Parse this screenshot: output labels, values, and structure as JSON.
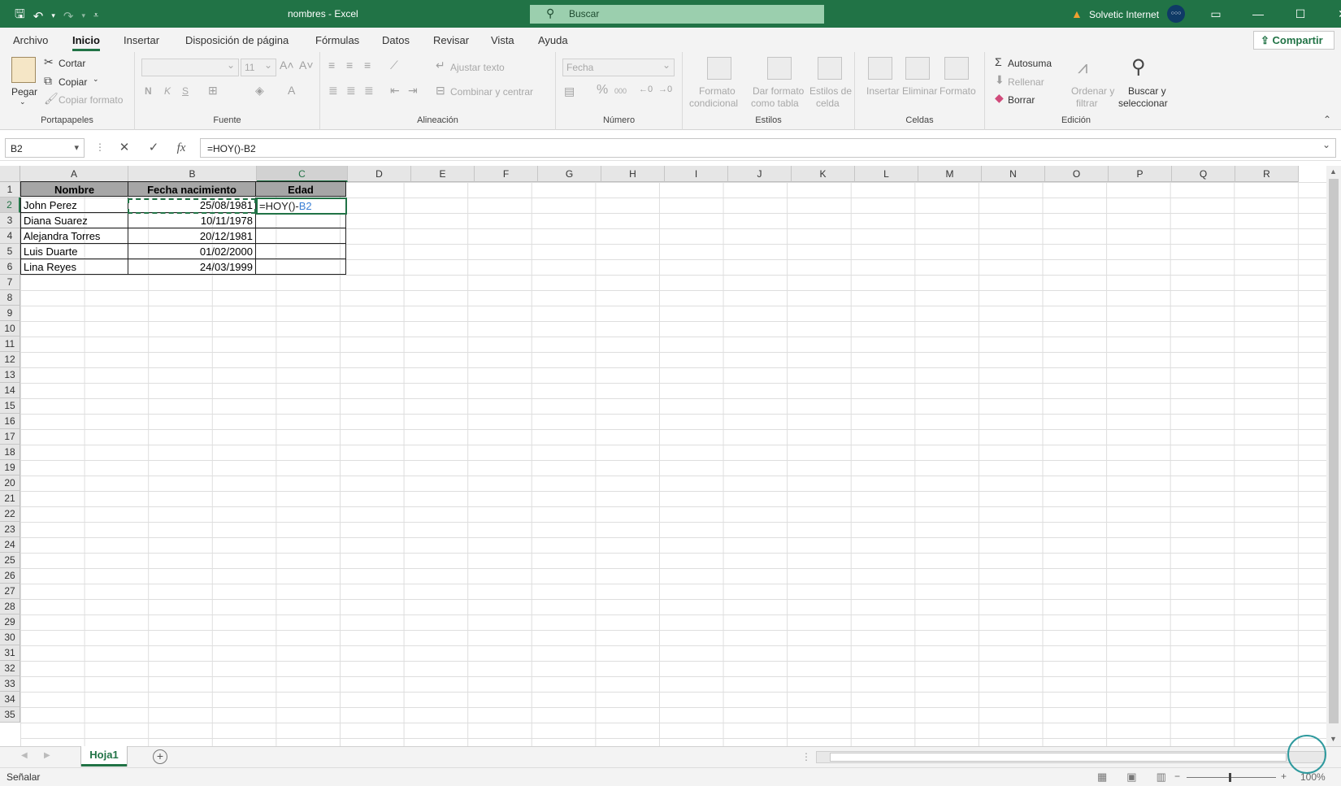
{
  "titlebar": {
    "title": "nombres - Excel",
    "search_placeholder": "Buscar",
    "user_name": "Solvetic Internet",
    "avatar_text": "○○○",
    "accent": "#217346"
  },
  "ribbon_tabs": [
    "Archivo",
    "Inicio",
    "Insertar",
    "Disposición de página",
    "Fórmulas",
    "Datos",
    "Revisar",
    "Vista",
    "Ayuda"
  ],
  "share_label": "Compartir",
  "clipboard": {
    "paste": "Pegar",
    "cut": "Cortar",
    "copy": "Copiar",
    "format_painter": "Copiar formato",
    "group": "Portapapeles"
  },
  "font": {
    "font_size": "11",
    "bold": "N",
    "italic": "K",
    "underline": "S",
    "group": "Fuente"
  },
  "alignment": {
    "wrap": "Ajustar texto",
    "merge": "Combinar y centrar",
    "group": "Alineación"
  },
  "number": {
    "format": "Fecha",
    "percent": "%",
    "thousands": "000",
    "group": "Número"
  },
  "styles": {
    "cond_format_1": "Formato",
    "cond_format_2": "condicional",
    "table_format_1": "Dar formato",
    "table_format_2": "como tabla",
    "cell_styles_1": "Estilos de",
    "cell_styles_2": "celda",
    "group": "Estilos"
  },
  "cells": {
    "insert": "Insertar",
    "delete": "Eliminar",
    "format": "Formato",
    "group": "Celdas"
  },
  "editing": {
    "autosum": "Autosuma",
    "fill": "Rellenar",
    "clear": "Borrar",
    "sort_1": "Ordenar y",
    "sort_2": "filtrar",
    "find_1": "Buscar y",
    "find_2": "seleccionar",
    "group": "Edición"
  },
  "formula_bar": {
    "name_box": "B2",
    "formula": "=HOY()-B2"
  },
  "columns": [
    "A",
    "B",
    "C",
    "D",
    "E",
    "F",
    "G",
    "H",
    "I",
    "J",
    "K",
    "L",
    "M",
    "N",
    "O",
    "P",
    "Q",
    "R"
  ],
  "rows": [
    "1",
    "2",
    "3",
    "4",
    "5",
    "6",
    "7",
    "8",
    "9",
    "10",
    "11",
    "12",
    "13",
    "14",
    "15",
    "16",
    "17",
    "18",
    "19",
    "20",
    "21",
    "22",
    "23",
    "24",
    "25",
    "26",
    "27",
    "28",
    "29",
    "30",
    "31",
    "32",
    "33",
    "34",
    "35"
  ],
  "table": {
    "headers": [
      "Nombre",
      "Fecha nacimiento",
      "Edad"
    ],
    "rows": [
      [
        "John Perez",
        "25/08/1981"
      ],
      [
        "Diana Suarez",
        "10/11/1978"
      ],
      [
        "Alejandra Torres",
        "20/12/1981"
      ],
      [
        "Luis Duarte",
        "01/02/2000"
      ],
      [
        "Lina Reyes",
        "24/03/1999"
      ]
    ]
  },
  "active_cell": {
    "prefix": "=HOY()-",
    "ref": "B2",
    "ref_color": "#3a7fd5"
  },
  "sheet_tab": "Hoja1",
  "status": {
    "mode": "Señalar",
    "zoom": "100%"
  }
}
